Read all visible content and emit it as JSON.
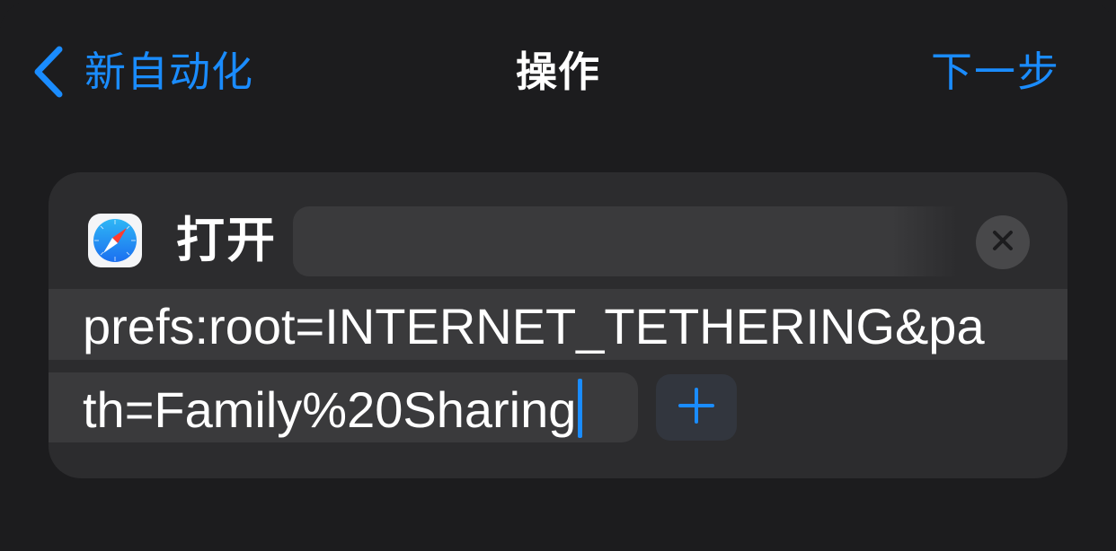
{
  "nav": {
    "back_label": "新自动化",
    "title": "操作",
    "next_label": "下一步"
  },
  "action": {
    "app_icon": "safari-icon",
    "label": "打开",
    "url_line1": "prefs:root=INTERNET_TETHERING&pa",
    "url_line2": "th=Family%20Sharing"
  },
  "colors": {
    "accent": "#1a8cff",
    "background": "#1c1c1e",
    "card": "#2c2c2e",
    "field": "#3a3a3c"
  }
}
